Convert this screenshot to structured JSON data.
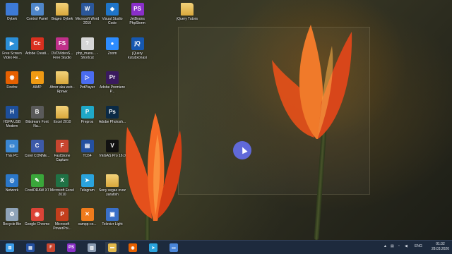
{
  "desktop": {
    "icons": [
      {
        "label": "Oybek",
        "icon": "user-folder-icon",
        "color": "#3d7ad6",
        "glyph": "",
        "col": 0,
        "row": 0
      },
      {
        "label": "Control Panel",
        "icon": "control-panel-icon",
        "color": "#4f86c9",
        "glyph": "⚙",
        "col": 1,
        "row": 0
      },
      {
        "label": "Видео Oybek",
        "icon": "folder-icon",
        "color": "#e2b84a",
        "glyph": "",
        "col": 2,
        "row": 0
      },
      {
        "label": "Microsoft Word 2010",
        "icon": "word-icon",
        "color": "#2b579a",
        "glyph": "W",
        "col": 3,
        "row": 0
      },
      {
        "label": "Visual Studio Code",
        "icon": "vscode-icon",
        "color": "#1f75c9",
        "glyph": "◆",
        "col": 4,
        "row": 0
      },
      {
        "label": "JetBrains PhpStorm",
        "icon": "phpstorm-icon",
        "color": "#8a2fc9",
        "glyph": "PS",
        "col": 5,
        "row": 0
      },
      {
        "label": "Free Screen Video Re...",
        "icon": "screen-recorder-icon",
        "color": "#2b8fd8",
        "glyph": "▶",
        "col": 0,
        "row": 1
      },
      {
        "label": "Adobe Creati...",
        "icon": "adobe-creative-cloud-icon",
        "color": "#d9301f",
        "glyph": "Cc",
        "col": 1,
        "row": 1
      },
      {
        "label": "DVDVideoS... Free Studio",
        "icon": "freestudio-icon",
        "color": "#c0308a",
        "glyph": "FS",
        "col": 2,
        "row": 1
      },
      {
        "label": "php_manu... - Shortcut",
        "icon": "php-manual-icon",
        "color": "#d6d6d6",
        "glyph": "?",
        "col": 3,
        "row": 1
      },
      {
        "label": "Zoom",
        "icon": "zoom-icon",
        "color": "#2d8cff",
        "glyph": "●",
        "col": 4,
        "row": 1
      },
      {
        "label": "jQuery kutubxonasi",
        "icon": "jquery-icon",
        "color": "#1658b0",
        "glyph": "jQ",
        "col": 5,
        "row": 1
      },
      {
        "label": "Firefox",
        "icon": "firefox-icon",
        "color": "#e66000",
        "glyph": "◉",
        "col": 0,
        "row": 2
      },
      {
        "label": "AIMP",
        "icon": "aimp-icon",
        "color": "#f09a13",
        "glyph": "▲",
        "col": 1,
        "row": 2
      },
      {
        "label": "Ahror aka web - Ярлык",
        "icon": "folder-icon",
        "color": "#e2b84a",
        "glyph": "",
        "col": 2,
        "row": 2
      },
      {
        "label": "PotPlayer",
        "icon": "potplayer-icon",
        "color": "#4a6cf0",
        "glyph": "▷",
        "col": 3,
        "row": 2
      },
      {
        "label": "Adobe Premiere P...",
        "icon": "premiere-icon",
        "color": "#3a1a5e",
        "glyph": "Pr",
        "col": 4,
        "row": 2
      },
      {
        "label": "HSPA USB Modem",
        "icon": "usb-modem-icon",
        "color": "#1e4f9a",
        "glyph": "H",
        "col": 0,
        "row": 3
      },
      {
        "label": "Bitstream Font Na...",
        "icon": "font-navigator-icon",
        "color": "#5a5a5a",
        "glyph": "B",
        "col": 1,
        "row": 3
      },
      {
        "label": "Excel 2010",
        "icon": "folder-icon",
        "color": "#e2b84a",
        "glyph": "",
        "col": 2,
        "row": 3
      },
      {
        "label": "Prepros",
        "icon": "prepros-icon",
        "color": "#1fa8c8",
        "glyph": "P",
        "col": 3,
        "row": 3
      },
      {
        "label": "Adobe Photosh...",
        "icon": "photoshop-icon",
        "color": "#0b2a45",
        "glyph": "Ps",
        "col": 4,
        "row": 3
      },
      {
        "label": "This PC",
        "icon": "this-pc-icon",
        "color": "#3a86d2",
        "glyph": "▭",
        "col": 0,
        "row": 4
      },
      {
        "label": "Corel CONNE...",
        "icon": "corel-connect-icon",
        "color": "#3d5aa8",
        "glyph": "C",
        "col": 1,
        "row": 4
      },
      {
        "label": "FastStone Capture",
        "icon": "faststone-capture-icon",
        "color": "#c8452f",
        "glyph": "F",
        "col": 2,
        "row": 4
      },
      {
        "label": "TC64",
        "icon": "tc64-icon",
        "color": "#2450a0",
        "glyph": "▤",
        "col": 3,
        "row": 4
      },
      {
        "label": "VEGAS Pro 16.0",
        "icon": "vegas-pro-icon",
        "color": "#111111",
        "glyph": "V",
        "col": 4,
        "row": 4
      },
      {
        "label": "Network",
        "icon": "network-icon",
        "color": "#2b77c8",
        "glyph": "◎",
        "col": 0,
        "row": 5
      },
      {
        "label": "CorelDRAW X7",
        "icon": "coreldraw-icon",
        "color": "#3aa63a",
        "glyph": "✎",
        "col": 1,
        "row": 5
      },
      {
        "label": "Microsoft Excel 2010",
        "icon": "excel-icon",
        "color": "#207245",
        "glyph": "X",
        "col": 2,
        "row": 5
      },
      {
        "label": "Telegram",
        "icon": "telegram-icon",
        "color": "#2aa3dd",
        "glyph": "➤",
        "col": 3,
        "row": 5
      },
      {
        "label": "Sony vegas ovoz yaratish",
        "icon": "folder-icon",
        "color": "#e2b84a",
        "glyph": "",
        "col": 4,
        "row": 5
      },
      {
        "label": "Recycle Bin",
        "icon": "recycle-bin-icon",
        "color": "#8fa3b8",
        "glyph": "♻",
        "col": 0,
        "row": 6
      },
      {
        "label": "Google Chrome",
        "icon": "chrome-icon",
        "color": "#db4437",
        "glyph": "◉",
        "col": 1,
        "row": 6
      },
      {
        "label": "Microsoft PowerPoi...",
        "icon": "powerpoint-icon",
        "color": "#c43e1c",
        "glyph": "P",
        "col": 2,
        "row": 6
      },
      {
        "label": "xampp-co...",
        "icon": "xampp-icon",
        "color": "#f07b1c",
        "glyph": "✕",
        "col": 3,
        "row": 6
      },
      {
        "label": "Televizr Light",
        "icon": "televizr-icon",
        "color": "#3a70c8",
        "glyph": "▣",
        "col": 4,
        "row": 6
      },
      {
        "label": "jQuery Tutors",
        "icon": "folder-icon",
        "color": "#e2b84a",
        "glyph": "",
        "col": 7,
        "row": 0
      }
    ]
  },
  "taskbar": {
    "items": [
      {
        "name": "start-button",
        "icon": "windows-icon",
        "color": "#3b9be8",
        "glyph": "⊞"
      },
      {
        "name": "taskbar-tc64",
        "icon": "tc64-icon",
        "color": "#2450a0",
        "glyph": "▤"
      },
      {
        "name": "taskbar-faststone",
        "icon": "faststone-capture-icon",
        "color": "#c8452f",
        "glyph": "F"
      },
      {
        "name": "taskbar-phpstorm",
        "icon": "phpstorm-icon",
        "color": "#8a2fc9",
        "glyph": "PS"
      },
      {
        "name": "taskbar-notes",
        "icon": "notes-icon",
        "color": "#8a9bb0",
        "glyph": "▥"
      },
      {
        "name": "taskbar-explorer",
        "icon": "file-explorer-icon",
        "color": "#e2b84a",
        "glyph": "▬"
      },
      {
        "name": "taskbar-firefox",
        "icon": "firefox-icon",
        "color": "#e66000",
        "glyph": "◉"
      },
      {
        "name": "taskbar-telegram",
        "icon": "telegram-icon",
        "color": "#2aa3dd",
        "glyph": "➤"
      },
      {
        "name": "taskbar-remote",
        "icon": "remote-desktop-icon",
        "color": "#4a86d8",
        "glyph": "▭"
      }
    ],
    "tray": {
      "language": "ENG",
      "time": "01:32",
      "date": "28.03.2020"
    }
  }
}
